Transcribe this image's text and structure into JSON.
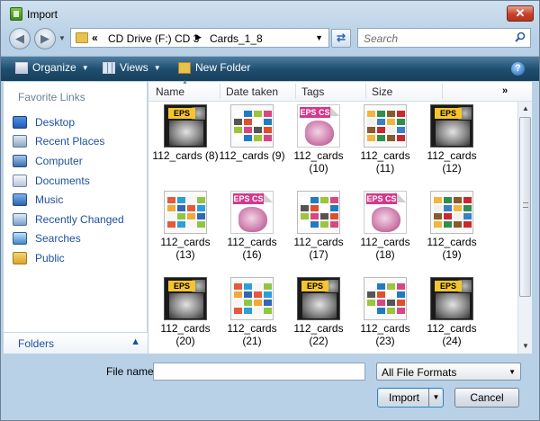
{
  "window": {
    "title": "Import",
    "close_label": "✕"
  },
  "address": {
    "segment1": "CD Drive (F:) CD 3",
    "segment2": "Cards_1_8",
    "chevron": "«"
  },
  "search": {
    "placeholder": "Search"
  },
  "toolbar": {
    "organize": "Organize",
    "views": "Views",
    "new_folder": "New Folder",
    "help": "?"
  },
  "nav": {
    "header": "Favorite Links",
    "items": [
      {
        "label": "Desktop",
        "icon": "desktop-icon"
      },
      {
        "label": "Recent Places",
        "icon": "recent-places-icon"
      },
      {
        "label": "Computer",
        "icon": "computer-icon"
      },
      {
        "label": "Documents",
        "icon": "documents-icon"
      },
      {
        "label": "Music",
        "icon": "music-icon"
      },
      {
        "label": "Recently Changed",
        "icon": "recently-changed-icon"
      },
      {
        "label": "Searches",
        "icon": "searches-icon"
      },
      {
        "label": "Public",
        "icon": "public-folder-icon"
      }
    ],
    "folders": "Folders"
  },
  "columns": [
    "Name",
    "Date taken",
    "Tags",
    "Size"
  ],
  "files": [
    {
      "name": "112_cards (8)",
      "type": "eps"
    },
    {
      "name": "112_cards (9)",
      "type": "sheet"
    },
    {
      "name": "112_cards (10)",
      "type": "epscs"
    },
    {
      "name": "112_cards (11)",
      "type": "sheet"
    },
    {
      "name": "112_cards (12)",
      "type": "eps"
    },
    {
      "name": "112_cards (13)",
      "type": "sheet"
    },
    {
      "name": "112_cards (16)",
      "type": "epscs"
    },
    {
      "name": "112_cards (17)",
      "type": "sheet"
    },
    {
      "name": "112_cards (18)",
      "type": "epscs"
    },
    {
      "name": "112_cards (19)",
      "type": "sheet"
    },
    {
      "name": "112_cards (20)",
      "type": "eps"
    },
    {
      "name": "112_cards (21)",
      "type": "sheet"
    },
    {
      "name": "112_cards (22)",
      "type": "eps"
    },
    {
      "name": "112_cards (23)",
      "type": "sheet"
    },
    {
      "name": "112_cards (24)",
      "type": "eps"
    }
  ],
  "bottom": {
    "file_name_label": "File name:",
    "file_name_value": "",
    "file_format": "All File Formats",
    "import": "Import",
    "cancel": "Cancel"
  },
  "colors": {
    "toolbar": "#1f4f71",
    "link": "#1d4f9e",
    "eps_tag": "#f4c52d",
    "epscs_tag": "#d6378c"
  }
}
